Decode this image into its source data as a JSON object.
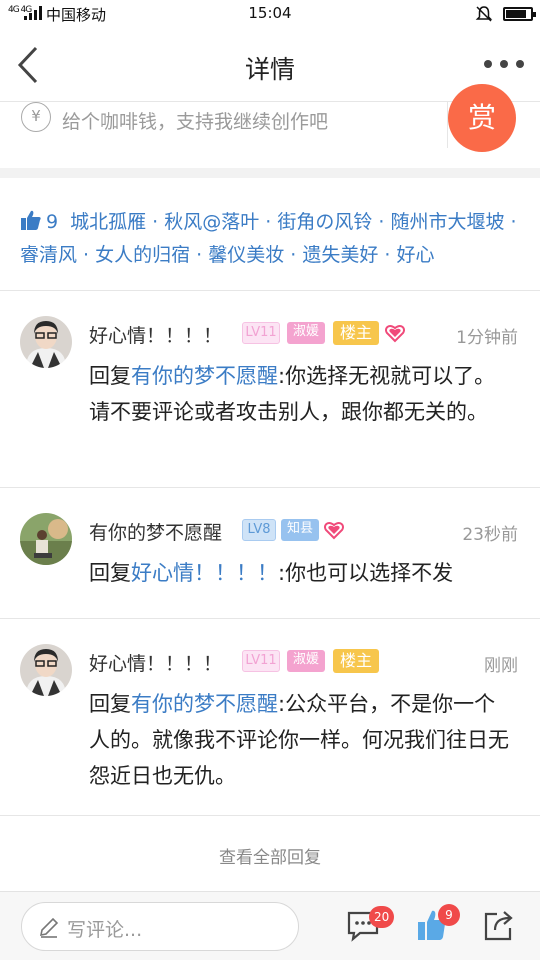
{
  "status_bar": {
    "network": "4G 4G",
    "carrier": "中国移动",
    "time": "15:04",
    "battery_level": 0.85
  },
  "header": {
    "title": "详情"
  },
  "tip": {
    "currency_icon": "¥",
    "text": "给个咖啡钱，支持我继续创作吧",
    "reward_label": "赏"
  },
  "likes": {
    "count": "9",
    "users": "城北孤雁 · 秋风@落叶 · 街角の风铃 · 随州市大堰坡 · 睿清风 · 女人的归宿 · 馨仪美妆 · 遗失美好 · 好心"
  },
  "comments": [
    {
      "name": "好心情！！！！",
      "level": "LV11",
      "title": "淑媛",
      "host_badge": "楼主",
      "time": "1分钟前",
      "reply_prefix": "回复",
      "reply_to": "有你的梦不愿醒",
      "text": ":你选择无视就可以了。请不要评论或者攻击别人，跟你都无关的。"
    },
    {
      "name": "有你的梦不愿醒",
      "level": "LV8",
      "title": "知县",
      "time": "23秒前",
      "reply_prefix": "回复",
      "reply_to": "好心情！！！！",
      "text": ":你也可以选择不发"
    },
    {
      "name": "好心情！！！！",
      "level": "LV11",
      "title": "淑媛",
      "host_badge": "楼主",
      "time": "刚刚",
      "reply_prefix": "回复",
      "reply_to": "有你的梦不愿醒",
      "text": ":公众平台，不是你一个人的。就像我不评论你一样。何况我们往日无怨近日也无仇。"
    }
  ],
  "view_all_label": "查看全部回复",
  "bottom_bar": {
    "input_placeholder": "写评论...",
    "comment_count": "20",
    "like_count": "9"
  },
  "colors": {
    "accent_blue": "#3b7cc5",
    "reward_orange": "#fa6a48",
    "host_gold": "#f7c64c",
    "badge_red": "#f04a4a"
  }
}
